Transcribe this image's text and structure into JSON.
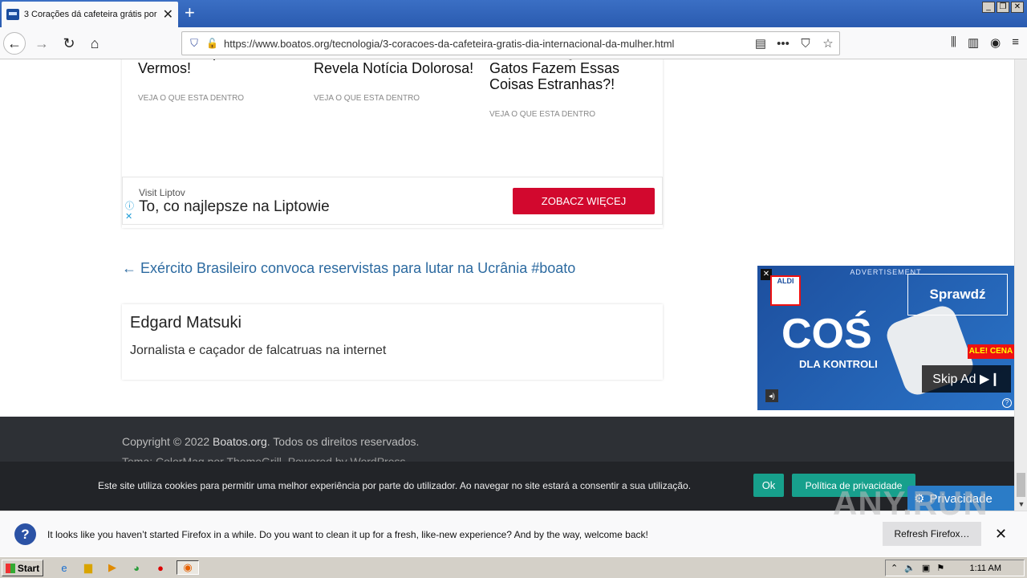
{
  "browser": {
    "tab_title": "3 Corações dá cafeteira grátis por",
    "url": "https://www.boatos.org/tecnologia/3-coracoes-da-cafeteira-gratis-dia-internacional-da-mulher.html"
  },
  "articles": [
    {
      "headline": "Não Era Suposto Vermos!",
      "cta": "VEJA O QUE ESTA DENTRO"
    },
    {
      "headline": "Teste De DNA E Médico Revela Notícia Dolorosa!",
      "cta": "VEJA O QUE ESTA DENTRO"
    },
    {
      "headline": "Gatos: Por Que Os Gatos Fazem Essas Coisas Estranhas?!",
      "cta": "VEJA O QUE ESTA DENTRO"
    }
  ],
  "ad_banner": {
    "sponsor": "Visit Liptov",
    "title": "To, co najlepsze na Liptowie",
    "button": "ZOBACZ WIĘCEJ"
  },
  "prev_post": "← Exército Brasileiro convoca reservistas para lutar na Ucrânia #boato",
  "author": {
    "name": "Edgard Matsuki",
    "bio": "Jornalista e caçador de falcatruas na internet"
  },
  "footer": {
    "copyright_prefix": "Copyright © 2022 ",
    "site": "Boatos.org",
    "copyright_suffix": ". Todos os direitos reservados.",
    "theme_line": "Tema: ColorMag por ThemeGrill. Powered by WordPress."
  },
  "video_ad": {
    "label": "ADVERTISEMENT",
    "brand": "ALDI",
    "headline": "COŚ",
    "subline": "DLA KONTROLI",
    "cta": "Sprawdź",
    "price_tag": "ALE! CENA",
    "skip": "Skip Ad ▶❙"
  },
  "cookie": {
    "message": "Este site utiliza cookies para permitir uma melhor experiência por parte do utilizador. Ao navegar no site estará a consentir a sua utilização.",
    "ok": "Ok",
    "policy": "Política de privacidade",
    "privacy_tab": "Privacidade"
  },
  "notification": {
    "message": "It looks like you haven’t started Firefox in a while. Do you want to clean it up for a fresh, like-new experience? And by the way, welcome back!",
    "button": "Refresh Firefox…"
  },
  "watermark": "ANY.RUN",
  "taskbar": {
    "start": "Start",
    "clock": "1:11 AM"
  }
}
